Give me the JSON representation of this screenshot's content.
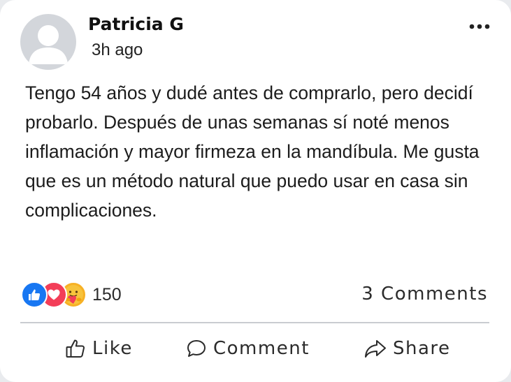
{
  "post": {
    "author": "Patricia G",
    "time": "3h ago",
    "text": "Tengo 54 años y dudé antes de comprarlo, pero decidí probarlo. Después de unas semanas sí noté menos inflamación y mayor firmeza en la mandíbula. Me gusta que es un método natural que puedo usar en casa sin complicaciones."
  },
  "stats": {
    "reaction_icons": [
      "like-icon",
      "love-icon",
      "care-icon"
    ],
    "reaction_count": "150",
    "comments": "3 Comments"
  },
  "actions": {
    "like": "Like",
    "comment": "Comment",
    "share": "Share"
  },
  "colors": {
    "like": "#1877f2",
    "love": "#f33e58",
    "care": "#f7b125",
    "avatar_bg": "#d3d6db"
  }
}
